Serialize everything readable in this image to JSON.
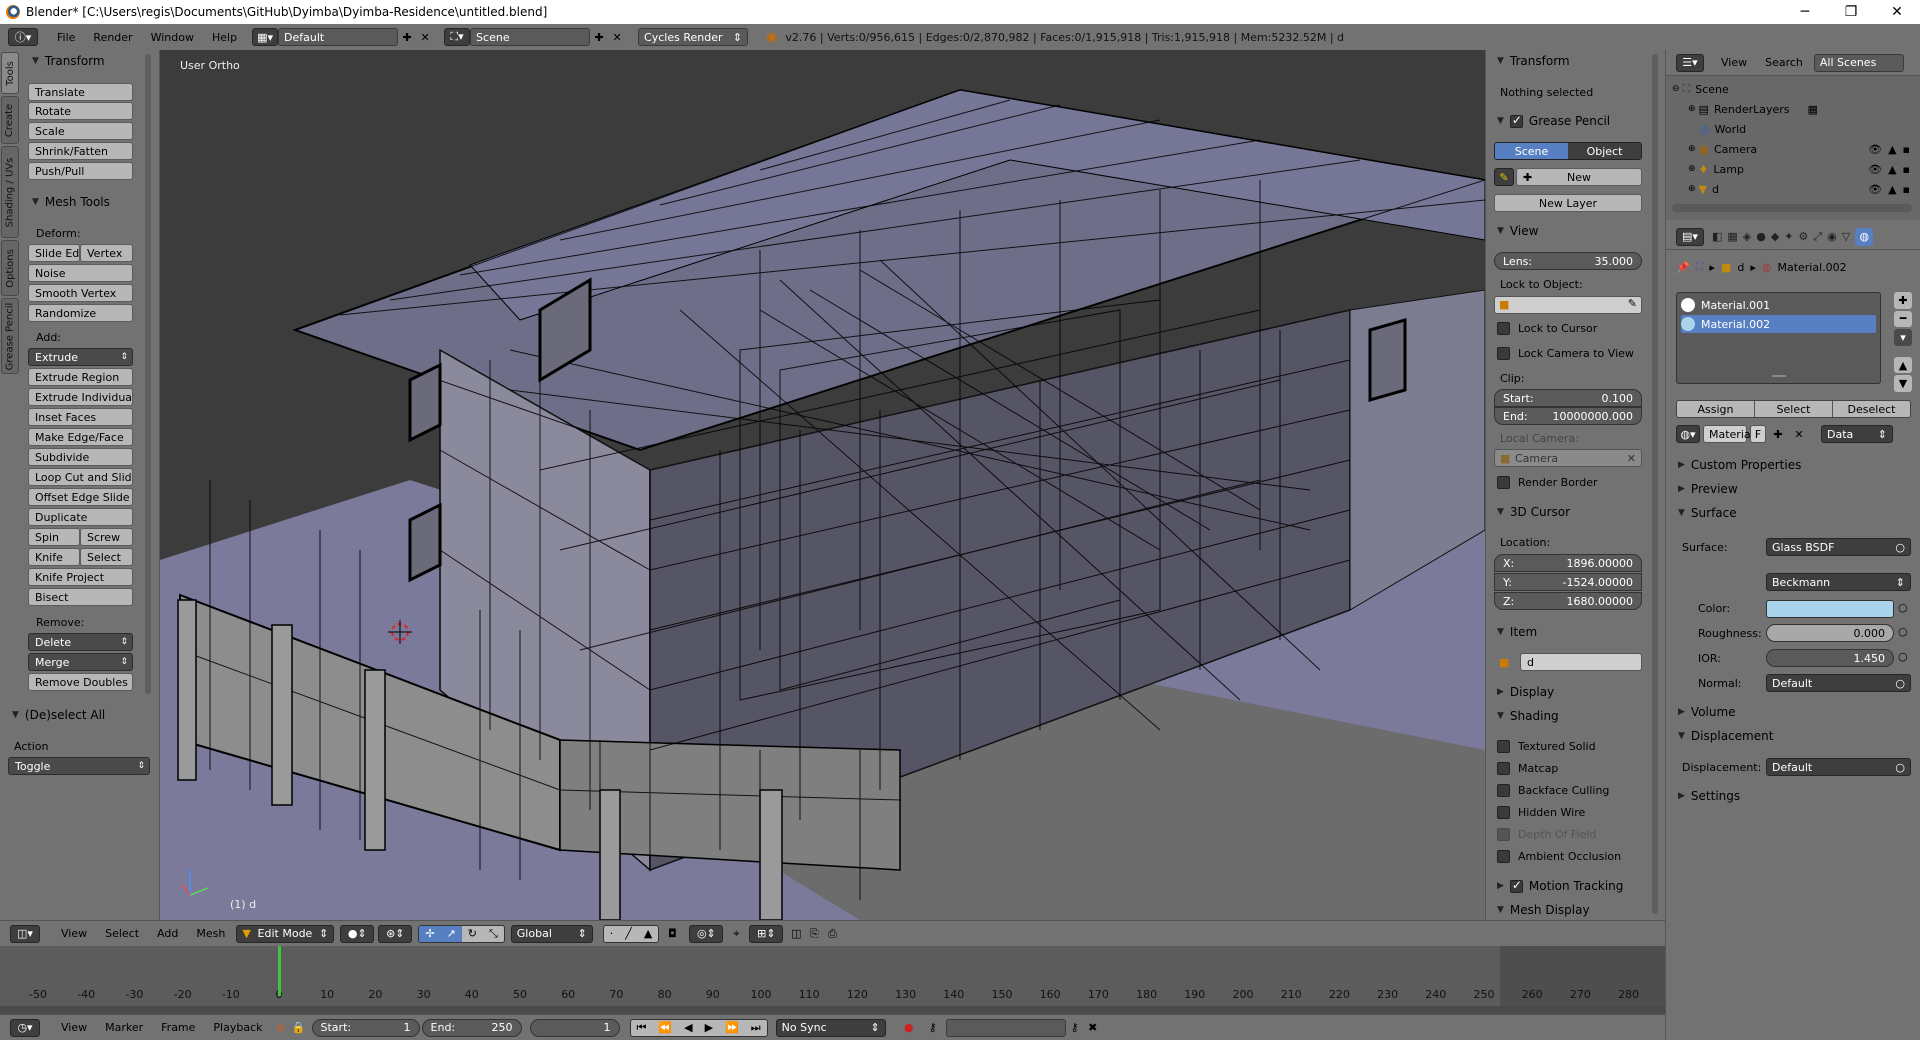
{
  "window": {
    "title": "Blender* [C:\\Users\\regis\\Documents\\GitHub\\Dyimba\\Dyimba-Residence\\untitled.blend]",
    "minimize": "─",
    "maximize": "❐",
    "close": "✕"
  },
  "menubar": {
    "menus": [
      "File",
      "Render",
      "Window",
      "Help"
    ],
    "screen_layout": "Default",
    "scene": "Scene",
    "render_engine": "Cycles Render",
    "stats": "v2.76 | Verts:0/956,615 | Edges:0/2,870,982 | Faces:0/1,915,918 | Tris:1,915,918 | Mem:5232.52M | d"
  },
  "toolshelf": {
    "tabs": [
      "Tools",
      "Create",
      "Shading / UVs",
      "Options",
      "Grease Pencil"
    ],
    "transform_title": "Transform",
    "transform_buttons": [
      "Translate",
      "Rotate",
      "Scale",
      "Shrink/Fatten",
      "Push/Pull"
    ],
    "mesh_tools_title": "Mesh Tools",
    "deform_label": "Deform:",
    "deform_row": [
      "Slide Ed",
      "Vertex"
    ],
    "deform_buttons": [
      "Noise",
      "Smooth Vertex",
      "Randomize"
    ],
    "add_label": "Add:",
    "extrude": "Extrude",
    "add_buttons": [
      "Extrude Region",
      "Extrude Individual",
      "Inset Faces",
      "Make Edge/Face",
      "Subdivide",
      "Loop Cut and Slide",
      "Offset Edge Slide",
      "Duplicate"
    ],
    "spin_row": [
      "Spin",
      "Screw"
    ],
    "knife_row": [
      "Knife",
      "Select"
    ],
    "knife_project": "Knife Project",
    "bisect": "Bisect",
    "remove_label": "Remove:",
    "delete": "Delete",
    "merge": "Merge",
    "remove_doubles": "Remove Doubles",
    "deselect_all_title": "(De)select All",
    "action_label": "Action",
    "action_value": "Toggle"
  },
  "viewport": {
    "view_label": "User Ortho",
    "object_label": "(1) d"
  },
  "npanel": {
    "transform_title": "Transform",
    "nothing_selected": "Nothing selected",
    "grease_pencil_title": "Grease Pencil",
    "gp_tabs": [
      "Scene",
      "Object"
    ],
    "gp_new": "New",
    "gp_new_layer": "New Layer",
    "view_title": "View",
    "lens_label": "Lens:",
    "lens_value": "35.000",
    "lock_to_object": "Lock to Object:",
    "lock_to_cursor": "Lock to Cursor",
    "lock_camera": "Lock Camera to View",
    "clip_label": "Clip:",
    "clip_start_label": "Start:",
    "clip_start": "0.100",
    "clip_end_label": "End:",
    "clip_end": "10000000.000",
    "local_camera": "Local Camera:",
    "camera_field": "Camera",
    "render_border": "Render Border",
    "cursor_title": "3D Cursor",
    "location_label": "Location:",
    "x_label": "X:",
    "x_value": "1896.00000",
    "y_label": "Y:",
    "y_value": "-1524.00000",
    "z_label": "Z:",
    "z_value": "1680.00000",
    "item_title": "Item",
    "item_name": "d",
    "display_title": "Display",
    "shading_title": "Shading",
    "shading_options": [
      "Textured Solid",
      "Matcap",
      "Backface Culling",
      "Hidden Wire",
      "Depth Of Field",
      "Ambient Occlusion"
    ],
    "motion_tracking": "Motion Tracking",
    "mesh_display": "Mesh Display"
  },
  "outliner": {
    "menus": [
      "View",
      "Search"
    ],
    "filter": "All Scenes",
    "items": [
      "Scene",
      "RenderLayers",
      "World",
      "Camera",
      "Lamp",
      "d"
    ]
  },
  "properties": {
    "breadcrumb_obj": "d",
    "breadcrumb_mat": "Material.002",
    "slots": [
      "Material.001",
      "Material.002"
    ],
    "assign": "Assign",
    "select": "Select",
    "deselect": "Deselect",
    "material_name": "Material.",
    "fake_user": "F",
    "link": "Data",
    "custom_properties": "Custom Properties",
    "preview": "Preview",
    "surface_title": "Surface",
    "surface_label": "Surface:",
    "surface_value": "Glass BSDF",
    "distribution": "Beckmann",
    "color_label": "Color:",
    "color_value": "#a9d4ec",
    "roughness_label": "Roughness:",
    "roughness_value": "0.000",
    "ior_label": "IOR:",
    "ior_value": "1.450",
    "normal_label": "Normal:",
    "normal_value": "Default",
    "volume": "Volume",
    "displacement_title": "Displacement",
    "displacement_label": "Displacement:",
    "displacement_value": "Default",
    "settings": "Settings"
  },
  "viewport_header": {
    "menus": [
      "View",
      "Select",
      "Add",
      "Mesh"
    ],
    "mode": "Edit Mode",
    "orientation": "Global"
  },
  "timeline": {
    "ticks": [
      "-50",
      "-40",
      "-30",
      "-20",
      "-10",
      "0",
      "10",
      "20",
      "30",
      "40",
      "50",
      "60",
      "70",
      "80",
      "90",
      "100",
      "110",
      "120",
      "130",
      "140",
      "150",
      "160",
      "170",
      "180",
      "190",
      "200",
      "210",
      "220",
      "230",
      "240",
      "250",
      "260",
      "270",
      "280"
    ],
    "current_frame_marker": 0
  },
  "timeline_header": {
    "menus": [
      "View",
      "Marker",
      "Frame",
      "Playback"
    ],
    "start_label": "Start:",
    "start_value": "1",
    "end_label": "End:",
    "end_value": "250",
    "current": "1",
    "sync": "No Sync"
  }
}
